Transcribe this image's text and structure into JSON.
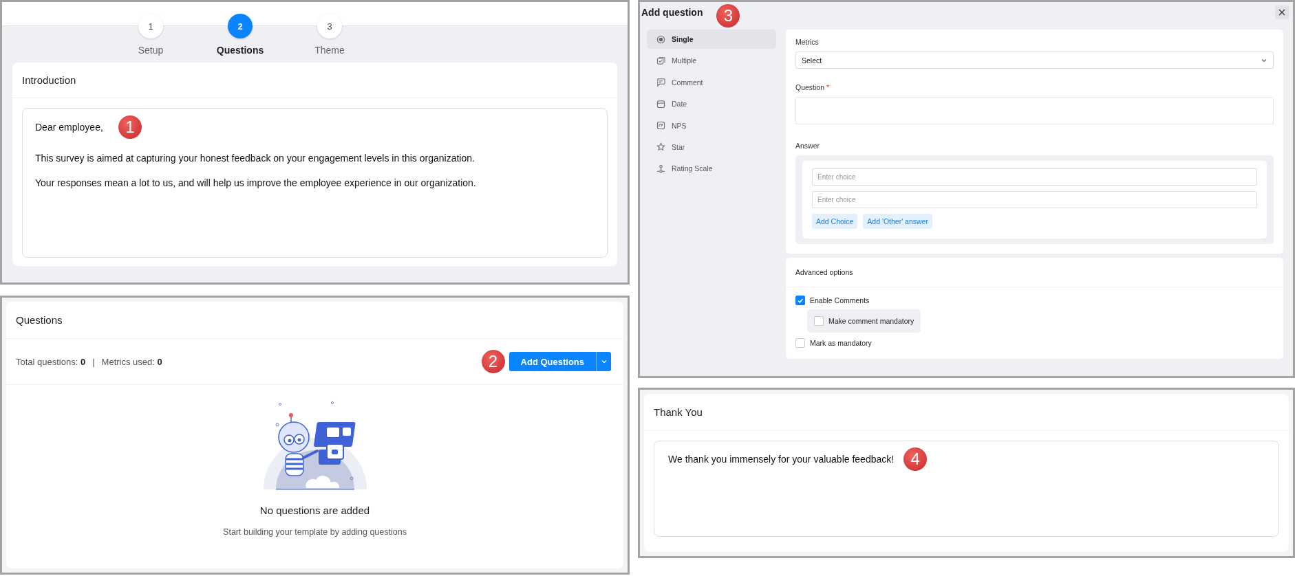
{
  "stepper": {
    "steps": [
      {
        "number": "1",
        "label": "Setup",
        "selected": false
      },
      {
        "number": "2",
        "label": "Questions",
        "selected": true
      },
      {
        "number": "3",
        "label": "Theme",
        "selected": false
      }
    ]
  },
  "introduction": {
    "title": "Introduction",
    "callout": "1",
    "paragraphs": [
      "Dear employee,",
      "This survey is aimed at capturing your honest feedback on your engagement levels in this organization.",
      "Your responses mean a lot to us, and will help us improve the employee experience in our organization."
    ]
  },
  "questions": {
    "title": "Questions",
    "callout": "2",
    "stats": [
      {
        "label": "Total questions:",
        "value": "0"
      },
      {
        "label": "Metrics used:",
        "value": "0"
      }
    ],
    "separator": "|",
    "add_button": "Add Questions",
    "empty_state": {
      "title": "No questions are added",
      "subtitle": "Start building your template by adding questions"
    }
  },
  "add_question": {
    "title": "Add question",
    "callout": "3",
    "question_types": [
      {
        "kind": "single",
        "label": "Single",
        "selected": true
      },
      {
        "kind": "multiple",
        "label": "Multiple",
        "selected": false
      },
      {
        "kind": "comment",
        "label": "Comment",
        "selected": false
      },
      {
        "kind": "date",
        "label": "Date",
        "selected": false
      },
      {
        "kind": "nps",
        "label": "NPS",
        "selected": false
      },
      {
        "kind": "star",
        "label": "Star",
        "selected": false
      },
      {
        "kind": "rating",
        "label": "Rating Scale",
        "selected": false
      }
    ],
    "metrics": {
      "label": "Metrics",
      "value": "Select"
    },
    "question": {
      "label": "Question",
      "required_mark": "*"
    },
    "answer": {
      "label": "Answer",
      "choices": [
        {
          "placeholder": "Enter choice"
        },
        {
          "placeholder": "Enter choice"
        }
      ],
      "actions": [
        "Add Choice",
        "Add 'Other' answer"
      ]
    },
    "advanced": {
      "title": "Advanced options",
      "options": [
        {
          "label": "Enable Comments",
          "checked": true,
          "children": [
            {
              "label": "Make comment mandatory",
              "checked": false
            }
          ]
        },
        {
          "label": "Mark as mandatory",
          "checked": false
        }
      ]
    }
  },
  "thank_you": {
    "title": "Thank You",
    "callout": "4",
    "message": "We thank you immensely for your valuable feedback!"
  }
}
